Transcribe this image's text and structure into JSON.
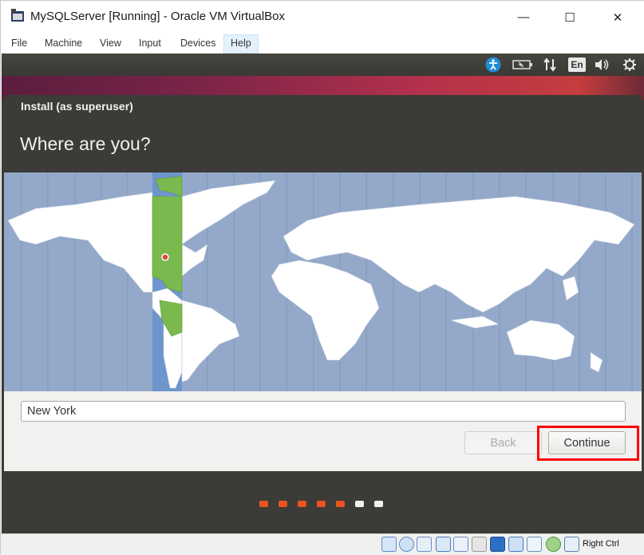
{
  "window": {
    "title": "MySQLServer [Running] - Oracle VM VirtualBox",
    "controls": {
      "minimize": "—",
      "maximize": "☐",
      "close": "✕"
    }
  },
  "menubar": {
    "items": [
      "File",
      "Machine",
      "View",
      "Input",
      "Devices",
      "Help"
    ],
    "active": "Help"
  },
  "panel": {
    "language": "En",
    "icons": [
      "accessibility-icon",
      "battery-icon",
      "network-icon",
      "keyboard-language-icon",
      "volume-icon",
      "power-icon"
    ]
  },
  "installer": {
    "window_title": "Install (as superuser)",
    "heading": "Where are you?",
    "location_value": "New York",
    "back_label": "Back",
    "continue_label": "Continue",
    "progress": {
      "total": 7,
      "completed": 5
    }
  },
  "statusbar": {
    "host_key": "Right Ctrl"
  },
  "colors": {
    "ubuntu_dark": "#3c3b37",
    "map_ocean": "#94a9c9",
    "timezone_band": "#6e95cc",
    "timezone_land": "#7ab94d",
    "progress_done": "#e95420",
    "progress_todo": "#f0f0f0",
    "highlight": "#ff0000"
  }
}
